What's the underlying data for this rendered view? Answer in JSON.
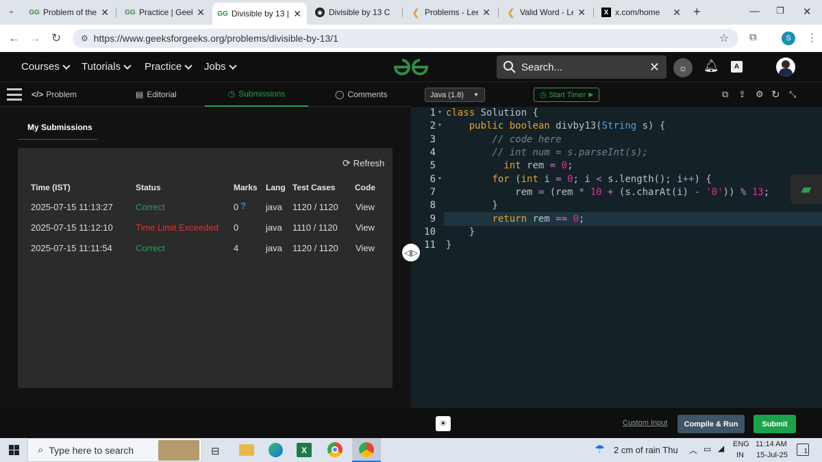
{
  "browser": {
    "tabs": [
      {
        "title": "Problem of the D",
        "favicon": "GG"
      },
      {
        "title": "Practice | Geeksf",
        "favicon": "GG"
      },
      {
        "title": "Divisible by 13 |",
        "favicon": "GG"
      },
      {
        "title": "Divisible by 13 C",
        "favicon": "globe"
      },
      {
        "title": "Problems - Leetc",
        "favicon": "leetcode"
      },
      {
        "title": "Valid Word - Lee",
        "favicon": "leetcode"
      },
      {
        "title": "x.com/home",
        "favicon": "X"
      }
    ],
    "url": "https://www.geeksforgeeks.org/problems/divisible-by-13/1",
    "profile_initial": "S"
  },
  "gfg_header": {
    "menus": [
      "Courses",
      "Tutorials",
      "Practice",
      "Jobs"
    ],
    "search_placeholder": "Search..."
  },
  "left_tabs": [
    "Problem",
    "Editorial",
    "Submissions",
    "Comments"
  ],
  "submissions": {
    "heading": "My Submissions",
    "refresh_label": "Refresh",
    "columns": [
      "Time (IST)",
      "Status",
      "Marks",
      "Lang",
      "Test Cases",
      "Code"
    ],
    "rows": [
      {
        "time": "2025-07-15 11:13:27",
        "status": "Correct",
        "status_color": "#2f9e57",
        "marks": "0",
        "marks_help": "?",
        "lang": "java",
        "tests": "1120 / 1120",
        "code": "View"
      },
      {
        "time": "2025-07-15 11:12:10",
        "status": "Time Limit Exceeded",
        "status_color": "#e03131",
        "marks": "0",
        "marks_help": "",
        "lang": "java",
        "tests": "1110 / 1120",
        "code": "View"
      },
      {
        "time": "2025-07-15 11:11:54",
        "status": "Correct",
        "status_color": "#2f9e57",
        "marks": "4",
        "marks_help": "",
        "lang": "java",
        "tests": "1120 / 1120",
        "code": "View"
      }
    ]
  },
  "editor": {
    "language": "Java (1.8)",
    "timer_label": "Start Timer",
    "line_numbers": [
      "1",
      "2",
      "3",
      "4",
      "5",
      "6",
      "7",
      "8",
      "9",
      "10",
      "11"
    ],
    "custom_input": "Custom Input",
    "compile_run": "Compile & Run",
    "submit": "Submit"
  },
  "taskbar": {
    "search_placeholder": "Type here to search",
    "weather": "2 cm of rain Thu",
    "lang_top": "ENG",
    "lang_bottom": "IN",
    "time": "11:14 AM",
    "date": "15-Jul-25",
    "notif_count": "1"
  },
  "colors": {
    "gfg_green": "#2f8d46",
    "status_green": "#2f9e57",
    "status_red": "#e03131",
    "compile_btn": "#3d5566",
    "submit_btn": "#1aa34a"
  }
}
